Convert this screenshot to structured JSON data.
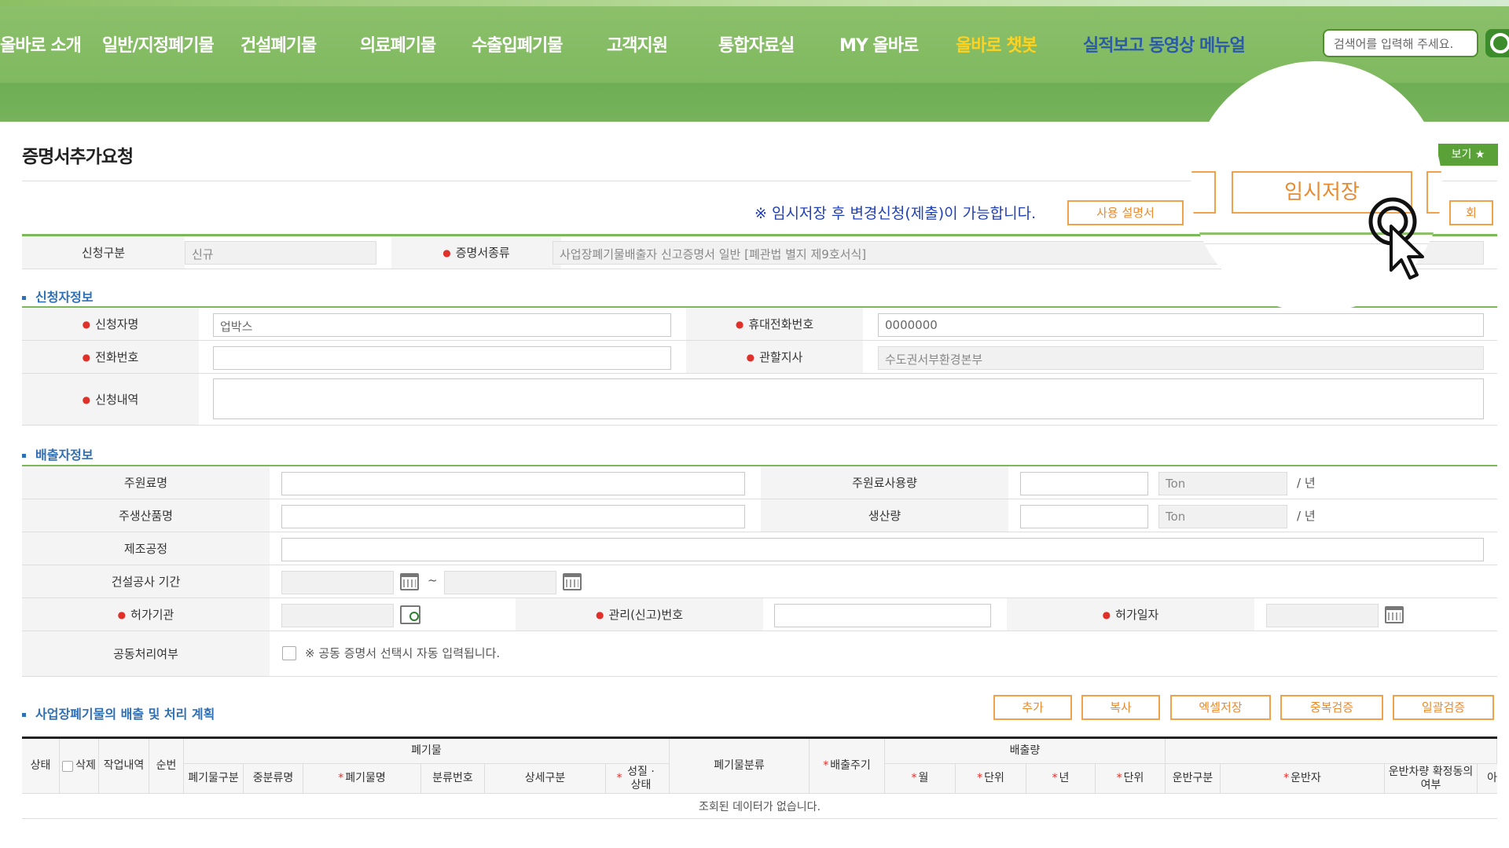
{
  "nav": {
    "items": [
      "올바로 소개",
      "일반/지정폐기물",
      "건설폐기물",
      "의료폐기물",
      "수출입폐기물",
      "고객지원",
      "통합자료실",
      "MY 올바로",
      "올바로 챗봇",
      "실적보고 동영상 메뉴얼"
    ],
    "search_placeholder": "검색어를 입력해 주세요."
  },
  "page": {
    "title": "증명서추가요청",
    "view_button": "보기",
    "notice": "※ 임시저장 후 변경신청(제출)이 가능합니다.",
    "manual_button": "사용 설명서",
    "temp_save_button": "임시저장",
    "partial_right_button": "회"
  },
  "basic": {
    "apply_type_label": "신청구분",
    "apply_type_value": "신규",
    "cert_type_label": "증명서종류",
    "cert_type_value": "사업장폐기물배출자 신고증명서 일반 [폐관법 별지 제9호서식]"
  },
  "applicant": {
    "section_title": "신청자정보",
    "name_label": "신청자명",
    "name_value": "업박스",
    "mobile_label": "휴대전화번호",
    "mobile_value": "0000000",
    "phone_label": "전화번호",
    "phone_value": "",
    "branch_label": "관할지사",
    "branch_value": "수도권서부환경본부",
    "detail_label": "신청내역",
    "detail_value": ""
  },
  "emitter": {
    "section_title": "배출자정보",
    "material_label": "주원료명",
    "material_usage_label": "주원료사용량",
    "product_label": "주생산품명",
    "production_label": "생산량",
    "unit_value": "Ton",
    "per_year": "/ 년",
    "process_label": "제조공정",
    "construction_period_label": "건설공사 기간",
    "range_sep": "~",
    "permit_org_label": "허가기관",
    "mgmt_no_label": "관리(신고)번호",
    "permit_date_label": "허가일자",
    "joint_label": "공동처리여부",
    "joint_note": "※ 공동 증명서 선택시 자동 입력됩니다."
  },
  "plan": {
    "section_title": "사업장폐기물의 배출 및 처리 계획",
    "buttons": [
      "추가",
      "복사",
      "엑셀저장",
      "중복검증",
      "일괄검증"
    ],
    "headers": {
      "status": "상태",
      "delete": "삭제",
      "history": "작업내역",
      "seq": "순번",
      "waste_group": "폐기물",
      "waste_type": "폐기물구분",
      "class_name": "중분류명",
      "waste_name": "폐기물명",
      "class_no": "분류번호",
      "detail_type": "상세구분",
      "property": "성질 · 상태",
      "waste_class": "폐기물분류",
      "cycle": "배출주기",
      "amount_group": "배출량",
      "month": "월",
      "unit1": "단위",
      "year": "년",
      "unit2": "단위",
      "transport_type": "운반구분",
      "transporter": "운반자",
      "vehicle": "운반차량 확정동의 여부",
      "partial": "아"
    },
    "empty_message": "조회된 데이터가 없습니다."
  }
}
